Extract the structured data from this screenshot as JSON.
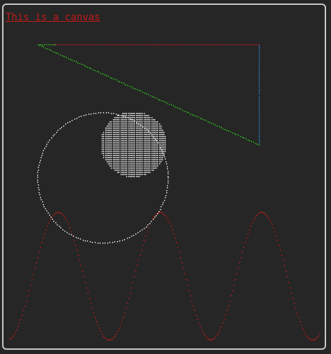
{
  "title": "This is a canvas",
  "colors": {
    "background": "#262626",
    "border": "#c8c8c8",
    "title": "#c21a1a",
    "red": "#c21a1a",
    "green": "#2ec41f",
    "blue": "#2f86d6",
    "white": "#eeeeee"
  }
}
